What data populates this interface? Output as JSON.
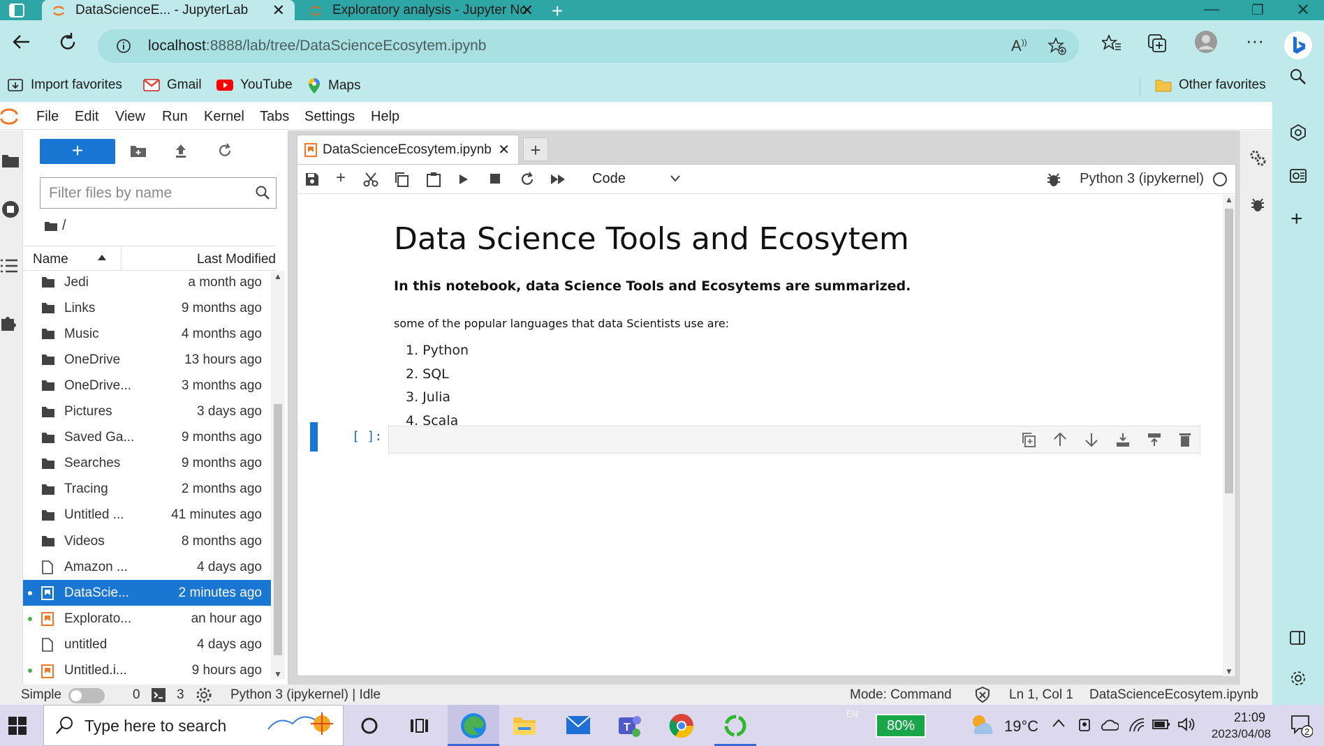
{
  "browser": {
    "tabs": [
      {
        "title": "DataScienceE... - JupyterLab",
        "active": true
      },
      {
        "title": "Exploratory analysis - Jupyter No",
        "active": false
      }
    ],
    "url": {
      "host": "localhost",
      "rest": ":8888/lab/tree/DataScienceEcosytem.ipynb"
    },
    "favorites": [
      {
        "label": "Import favorites",
        "icon": "import-icon"
      },
      {
        "label": "Gmail",
        "icon": "gmail-icon"
      },
      {
        "label": "YouTube",
        "icon": "youtube-icon"
      },
      {
        "label": "Maps",
        "icon": "maps-icon"
      }
    ],
    "other_favorites": "Other favorites"
  },
  "jupyter": {
    "menu": [
      "File",
      "Edit",
      "View",
      "Run",
      "Kernel",
      "Tabs",
      "Settings",
      "Help"
    ],
    "filebrowser": {
      "filter_placeholder": "Filter files by name",
      "breadcrumb": "/",
      "columns": {
        "name": "Name",
        "modified": "Last Modified"
      },
      "files": [
        {
          "name": "Jedi",
          "modified": "a month ago",
          "type": "folder"
        },
        {
          "name": "Links",
          "modified": "9 months ago",
          "type": "folder"
        },
        {
          "name": "Music",
          "modified": "4 months ago",
          "type": "folder"
        },
        {
          "name": "OneDrive",
          "modified": "13 hours ago",
          "type": "folder"
        },
        {
          "name": "OneDrive...",
          "modified": "3 months ago",
          "type": "folder"
        },
        {
          "name": "Pictures",
          "modified": "3 days ago",
          "type": "folder"
        },
        {
          "name": "Saved Ga...",
          "modified": "9 months ago",
          "type": "folder"
        },
        {
          "name": "Searches",
          "modified": "9 months ago",
          "type": "folder"
        },
        {
          "name": "Tracing",
          "modified": "2 months ago",
          "type": "folder"
        },
        {
          "name": "Untitled ...",
          "modified": "41 minutes ago",
          "type": "folder"
        },
        {
          "name": "Videos",
          "modified": "8 months ago",
          "type": "folder"
        },
        {
          "name": "Amazon ...",
          "modified": "4 days ago",
          "type": "file"
        },
        {
          "name": "DataScie...",
          "modified": "2 minutes ago",
          "type": "notebook",
          "selected": true,
          "running": true
        },
        {
          "name": "Explorato...",
          "modified": "an hour ago",
          "type": "notebook",
          "running": true
        },
        {
          "name": "untitled",
          "modified": "4 days ago",
          "type": "file"
        },
        {
          "name": "Untitled.i...",
          "modified": "9 hours ago",
          "type": "notebook",
          "running": true
        }
      ]
    },
    "notebook": {
      "tab_title": "DataScienceEcosytem.ipynb",
      "cell_type": "Code",
      "kernel": "Python 3 (ipykernel)",
      "heading": "Data Science Tools and Ecosytem",
      "intro_bold": "In this notebook, data Science Tools and Ecosytems are summarized.",
      "languages_intro": "some of the popular languages that data Scientists use are:",
      "languages": [
        "1. Python",
        "2. SQL",
        "3. Julia",
        "4. Scala"
      ],
      "prompt": "[ ]:"
    },
    "status": {
      "mode_label": "Simple",
      "terminals": "0",
      "kernels": "3",
      "kernel_status": "Python 3 (ipykernel) | Idle",
      "mode": "Mode: Command",
      "position": "Ln 1, Col 1",
      "file": "DataScienceEcosytem.ipynb"
    }
  },
  "taskbar": {
    "search_placeholder": "Type here to search",
    "battery": "80%",
    "temperature": "19°C",
    "time": "21:09",
    "date": "2023/04/08",
    "lang": "EN",
    "notifications": "2"
  },
  "colors": {
    "accent": "#1976d2",
    "browser_bg": "#bfe9ea",
    "tabstrip": "#2fa6a6",
    "jupyter_orange": "#f37726"
  }
}
